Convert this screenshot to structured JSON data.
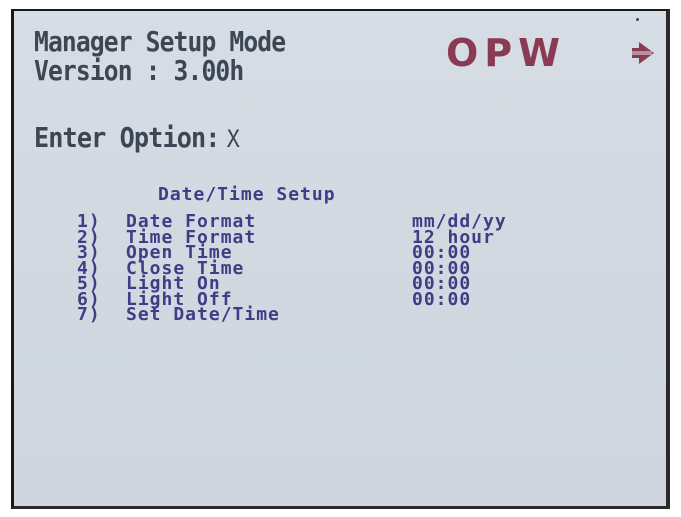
{
  "header": {
    "line1": "Manager Setup Mode",
    "line2": "Version : 3.00h"
  },
  "logo": {
    "text": "OPW",
    "color": "#8a3a52",
    "icon": "arrow-logo-icon"
  },
  "prompt": {
    "label": "Enter Option:",
    "cursor": "X"
  },
  "menu": {
    "title": "Date/Time Setup",
    "options": [
      {
        "num": "1)",
        "label": "Date Format",
        "value": "mm/dd/yy"
      },
      {
        "num": "2)",
        "label": "Time Format",
        "value": "12 hour"
      },
      {
        "num": "3)",
        "label": "Open Time",
        "value": "00:00"
      },
      {
        "num": "4)",
        "label": "Close Time",
        "value": "00:00"
      },
      {
        "num": "5)",
        "label": "Light On",
        "value": "00:00"
      },
      {
        "num": "6)",
        "label": "Light Off",
        "value": "00:00"
      },
      {
        "num": "7)",
        "label": "Set Date/Time",
        "value": ""
      }
    ]
  },
  "colors": {
    "screen_bg": "#d4dbe2",
    "text_dark": "#3d4655",
    "text_blue": "#3f3d86"
  }
}
